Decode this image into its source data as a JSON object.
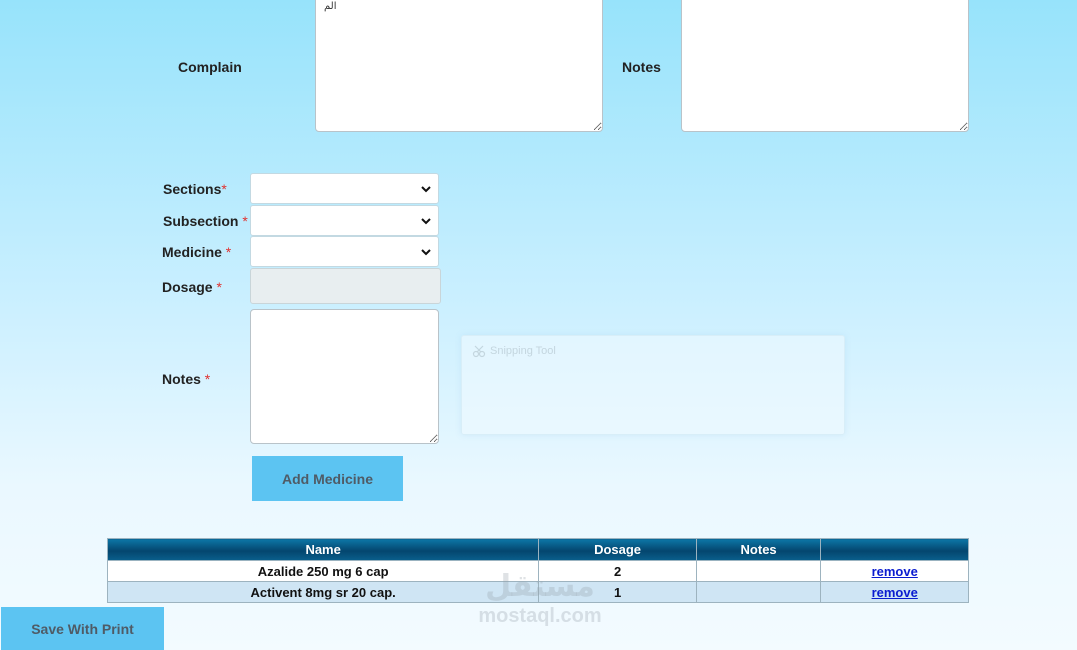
{
  "complaint": {
    "label": "Complain",
    "value": "الم"
  },
  "notes_top": {
    "label": "Notes",
    "value": ""
  },
  "form": {
    "sections": {
      "label": "Sections",
      "required_mark": "*",
      "value": ""
    },
    "subsection": {
      "label": "Subsection",
      "required_mark": "*",
      "value": ""
    },
    "medicine": {
      "label": "Medicine",
      "required_mark": "*",
      "value": ""
    },
    "dosage": {
      "label": "Dosage",
      "required_mark": "*",
      "value": ""
    },
    "notes": {
      "label": "Notes",
      "required_mark": "*",
      "value": ""
    },
    "add_button": "Add Medicine"
  },
  "overlay": {
    "title": "Snipping Tool",
    "icon": "scissors-icon"
  },
  "medicines_table": {
    "headers": [
      "Name",
      "Dosage",
      "Notes",
      ""
    ],
    "rows": [
      {
        "name": "Azalide 250 mg 6 cap",
        "dosage": "2",
        "notes": "",
        "action": "remove"
      },
      {
        "name": "Activent 8mg sr 20 cap.",
        "dosage": "1",
        "notes": "",
        "action": "remove"
      }
    ]
  },
  "save_button": "Save With Print",
  "watermark": {
    "arabic": "مستقل",
    "latin": "mostaql.com"
  },
  "colors": {
    "header_bar": "#04466e",
    "button": "#5cc4f2",
    "row_alt": "#cfe5f4",
    "required": "#e0312f",
    "link": "#0a1bd0"
  }
}
